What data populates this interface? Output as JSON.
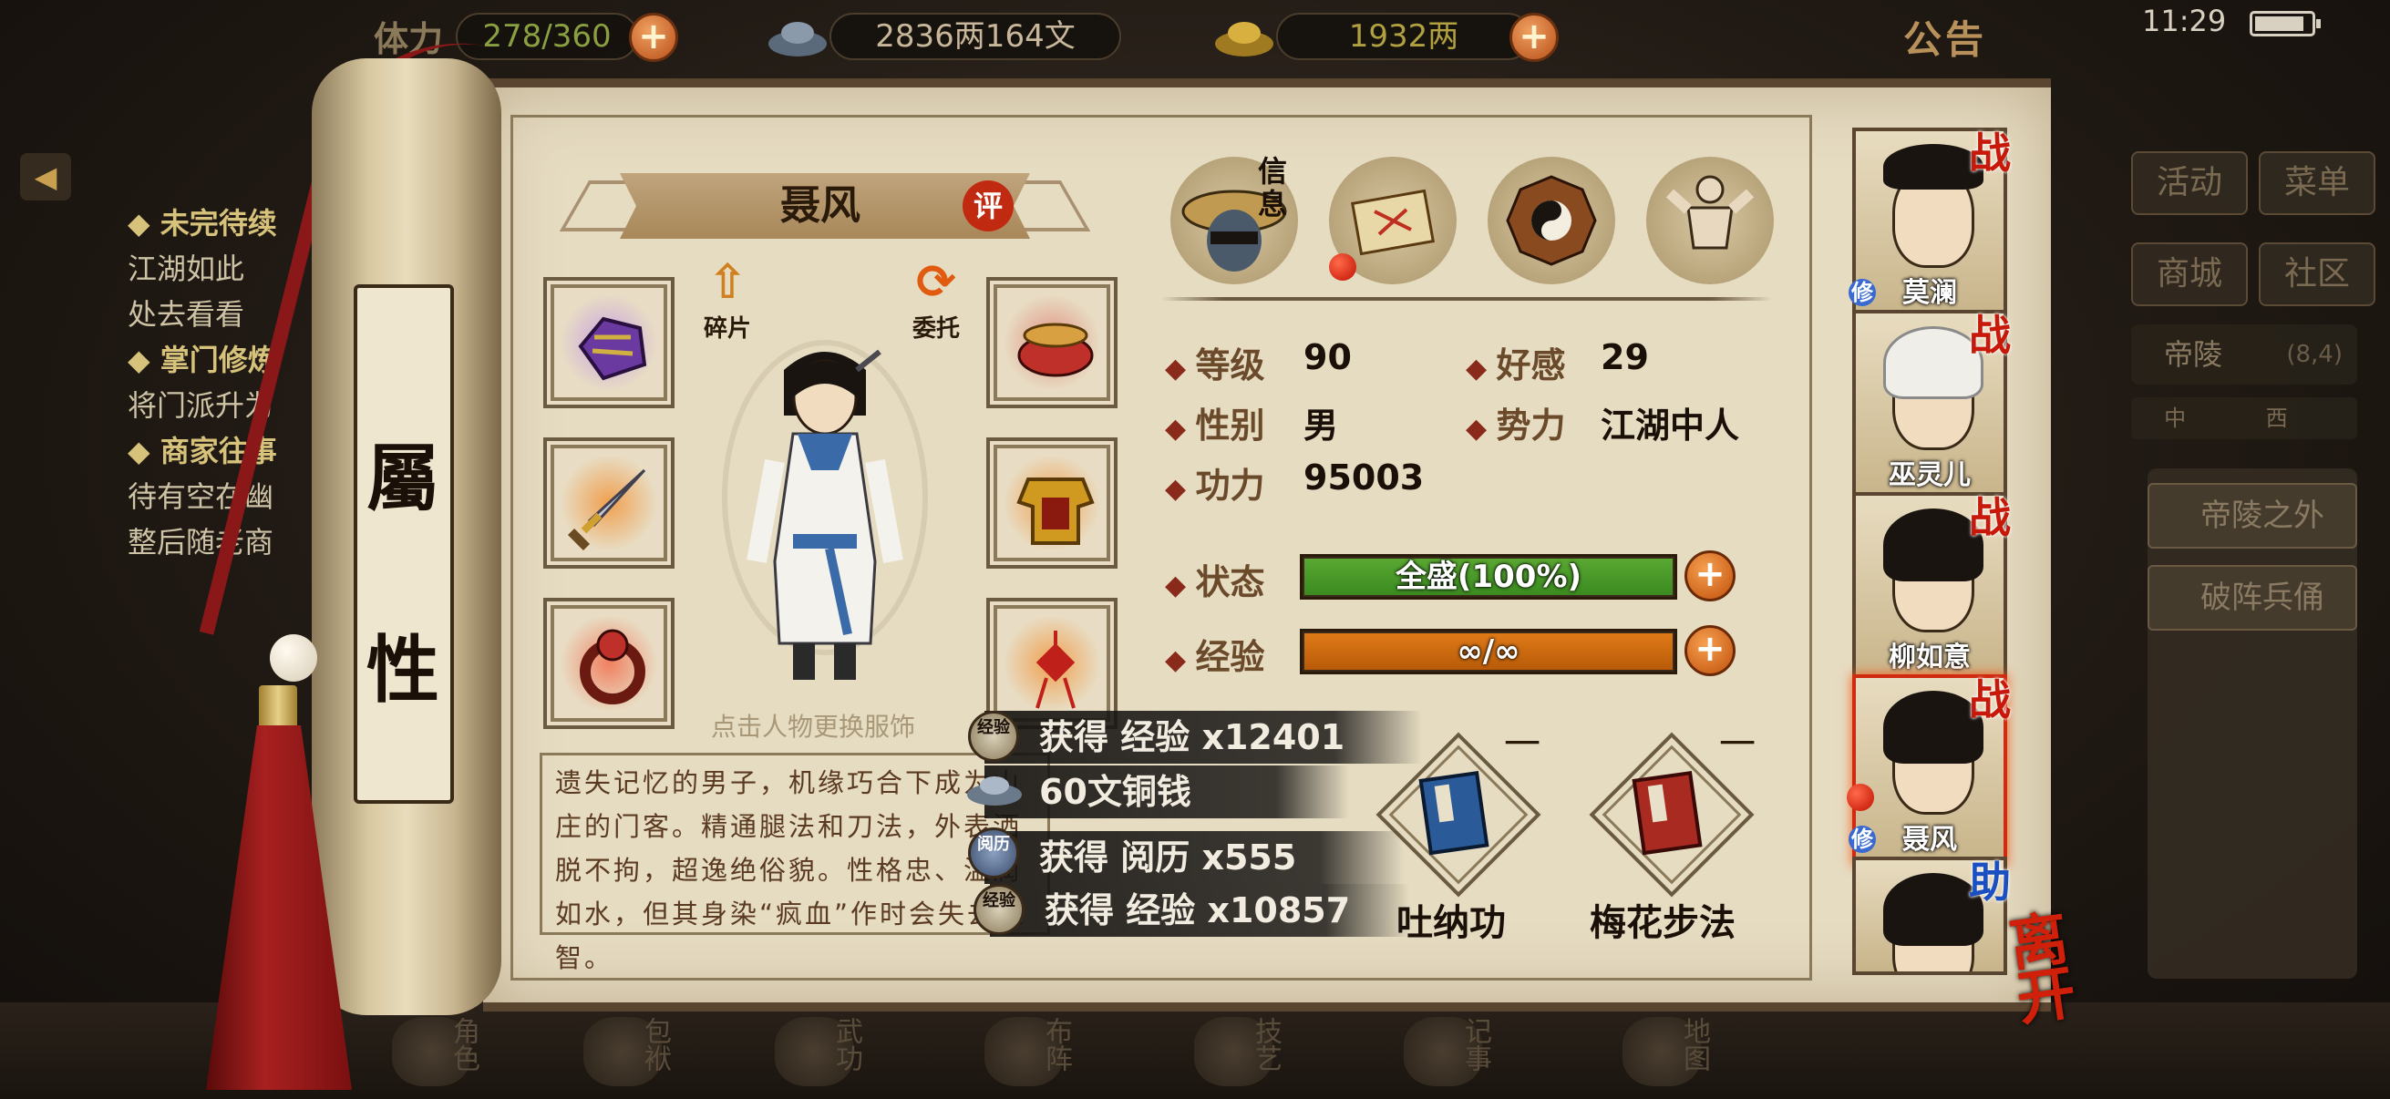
{
  "hud": {
    "stamina_label": "体力",
    "stamina": "278/360",
    "copper": "2836两164文",
    "gold": "1932两",
    "notice": "公告",
    "clock": "11:29"
  },
  "quests": [
    {
      "title": "未完待续",
      "lines": [
        "江湖如此",
        "处去看看"
      ]
    },
    {
      "title": "掌门修炼",
      "lines": [
        "将门派升为"
      ]
    },
    {
      "title": "商家往事",
      "lines": [
        "待有空在幽",
        "整后随老商"
      ]
    }
  ],
  "right_menu": {
    "activity": "活动",
    "menu": "菜单",
    "shop": "商城",
    "community": "社区",
    "location": "帝陵",
    "coord": "(8,4)",
    "compass": "中 西",
    "dest1": "帝陵之外",
    "dest2": "破阵兵俑"
  },
  "scroll": {
    "title_top": "屬",
    "title_bottom": "性"
  },
  "hero": {
    "name": "聂风",
    "rate": "评",
    "fragment": "碎片",
    "delegate": "委托",
    "change_outfit": "点击人物更换服饰",
    "bio": "遗失记忆的男子，机缘巧合下成为山庄的门客。精通腿法和刀法，外表洒脱不拘，超逸绝俗貌。性格忠、温润如水，但其身染“疯血”作时会失去理智。"
  },
  "tabs": {
    "info_label": "信息"
  },
  "stats": {
    "level_label": "等级",
    "level": "90",
    "affection_label": "好感",
    "affection": "29",
    "gender_label": "性别",
    "gender": "男",
    "faction_label": "势力",
    "faction": "江湖中人",
    "power_label": "功力",
    "power": "95003",
    "status_label": "状态",
    "status_text": "全盛(100%)",
    "status_fraction": 1.0,
    "exp_label": "经验",
    "exp_text": "∞/∞",
    "exp_fraction": 1.0,
    "plus": "+"
  },
  "skills": [
    {
      "name": "吐纳功",
      "level": "一"
    },
    {
      "name": "梅花步法",
      "level": "一"
    }
  ],
  "notifications": [
    {
      "icon": "经验",
      "text": "获得 经验 x12401"
    },
    {
      "icon": "",
      "text": "60文铜钱"
    },
    {
      "icon": "阅历",
      "text": "获得 阅历 x555"
    },
    {
      "icon": "经验",
      "text": "获得 经验 x10857"
    }
  ],
  "party": [
    {
      "name": "莫澜",
      "badge": "战",
      "cultivate": "修"
    },
    {
      "name": "巫灵儿",
      "badge": "战",
      "cultivate": ""
    },
    {
      "name": "柳如意",
      "badge": "战",
      "cultivate": ""
    },
    {
      "name": "聂风",
      "badge": "战",
      "cultivate": "修"
    },
    {
      "name": "",
      "badge": "助",
      "cultivate": ""
    }
  ],
  "leave": "离开",
  "bottom_nav": [
    "角色",
    "包袱",
    "武功",
    "布阵",
    "技艺",
    "记事",
    "地图"
  ],
  "colors": {
    "status_bar": "#5aa832",
    "exp_bar": "#e07a18",
    "war_badge": "#c8180a",
    "help_badge": "#1a50c0"
  }
}
